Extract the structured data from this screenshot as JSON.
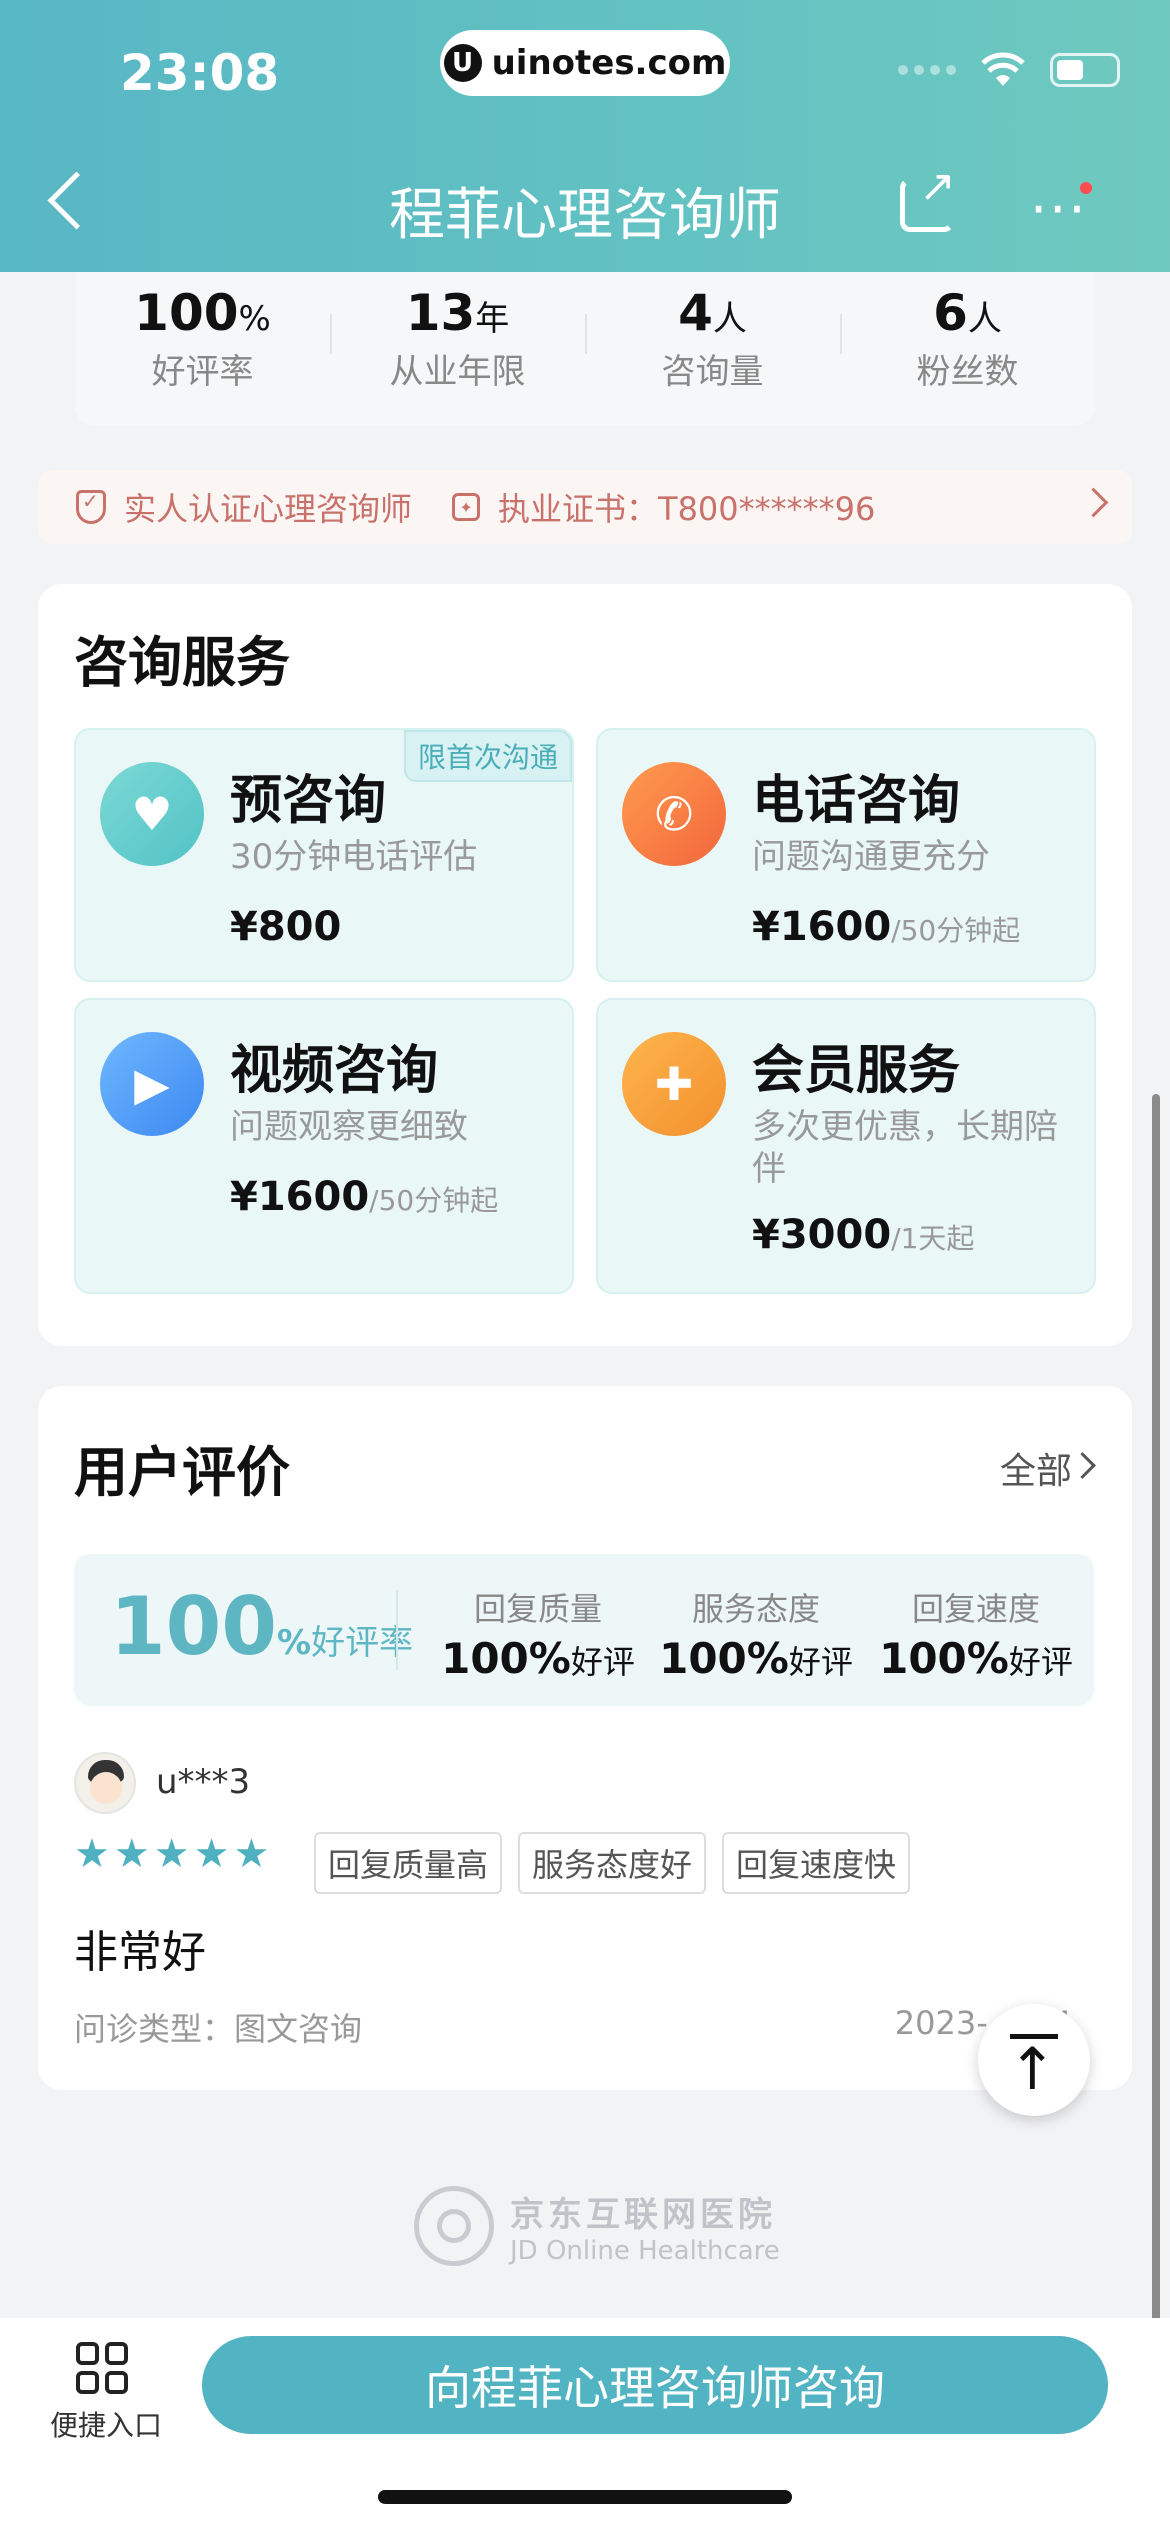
{
  "status_bar": {
    "time": "23:08",
    "url": "uinotes.com"
  },
  "nav": {
    "title": "程菲心理咨询师"
  },
  "stats": [
    {
      "value": "100",
      "unit": "%",
      "label": "好评率"
    },
    {
      "value": "13",
      "unit": "年",
      "label": "从业年限"
    },
    {
      "value": "4",
      "unit": "人",
      "label": "咨询量"
    },
    {
      "value": "6",
      "unit": "人",
      "label": "粉丝数"
    }
  ],
  "cert": {
    "verified": "实人认证心理咨询师",
    "license": "执业证书：T800******96"
  },
  "services": {
    "title": "咨询服务",
    "items": [
      {
        "name": "预咨询",
        "desc": "30分钟电话评估",
        "price": "¥800",
        "unit": "",
        "tag": "限首次沟通",
        "icon": "chat-bubble-icon"
      },
      {
        "name": "电话咨询",
        "desc": "问题沟通更充分",
        "price": "¥1600",
        "unit": "/50分钟起",
        "icon": "phone-icon"
      },
      {
        "name": "视频咨询",
        "desc": "问题观察更细致",
        "price": "¥1600",
        "unit": "/50分钟起",
        "icon": "video-icon"
      },
      {
        "name": "会员服务",
        "desc": "多次更优惠，长期陪伴",
        "price": "¥3000",
        "unit": "/1天起",
        "icon": "medical-kit-icon"
      }
    ]
  },
  "reviews": {
    "title": "用户评价",
    "see_all": "全部",
    "rating": {
      "value": "100",
      "pct": "%",
      "label": "好评率"
    },
    "metrics": [
      {
        "label": "回复质量",
        "value": "100%",
        "sub": "好评"
      },
      {
        "label": "服务态度",
        "value": "100%",
        "sub": "好评"
      },
      {
        "label": "回复速度",
        "value": "100%",
        "sub": "好评"
      }
    ],
    "item": {
      "user": "u***3",
      "stars": 5,
      "tags": [
        "回复质量高",
        "服务态度好",
        "回复速度快"
      ],
      "text": "非常好",
      "type": "问诊类型：图文咨询",
      "date": "2023-…-14"
    }
  },
  "footer": {
    "brand_cn": "京东互联网医院",
    "brand_en": "JD Online Healthcare"
  },
  "bottom": {
    "shortcut": "便捷入口",
    "consult": "向程菲心理咨询师咨询"
  },
  "colors": {
    "accent": "#52b4c3",
    "cert": "#c8726b"
  }
}
